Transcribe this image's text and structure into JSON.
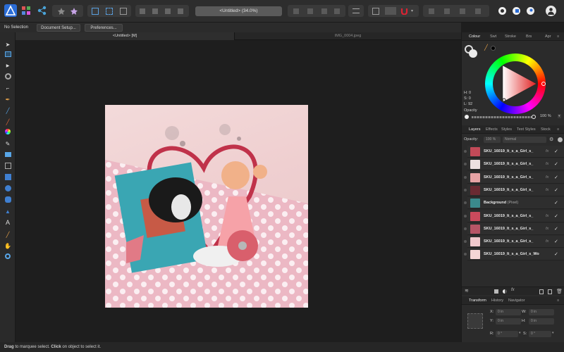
{
  "toolbar": {
    "document_title": "<Untitled> (34.0%)"
  },
  "context": {
    "selection": "No Selection",
    "document_setup": "Document Setup...",
    "preferences": "Preferences..."
  },
  "document_tabs": [
    {
      "label": "<Untitled> [M]",
      "active": true
    },
    {
      "label": "IMG_0004.jpeg",
      "active": false
    }
  ],
  "colour_panel": {
    "tabs": [
      "Colour",
      "Swt",
      "Stroke",
      "Brs",
      "Apr"
    ],
    "hsl": {
      "h": "H: 0",
      "s": "S: 0",
      "l": "L: 92"
    },
    "opacity_label": "Opacity",
    "opacity_value": "100 %"
  },
  "layers_panel": {
    "tabs": [
      "Layers",
      "Effects",
      "Styles",
      "Text Styles",
      "Stock"
    ],
    "opacity_label": "Opacity:",
    "opacity_value": "100 %",
    "blend_mode": "Normal",
    "layers": [
      {
        "name": "SKU_16019_It_s_a_Girl_s_",
        "kind": "",
        "fx": "fx",
        "check": "✓",
        "thumb": "#c24a58"
      },
      {
        "name": "SKU_16019_It_s_a_Girl_s_",
        "kind": "",
        "fx": "fx",
        "check": "✓",
        "thumb": "#ece0e0"
      },
      {
        "name": "SKU_16019_It_s_a_Girl_s_",
        "kind": "",
        "fx": "fx",
        "check": "✓",
        "thumb": "#e6a2a4"
      },
      {
        "name": "SKU_16019_It_s_a_Girl_s_",
        "kind": "",
        "fx": "fx",
        "check": "✓",
        "thumb": "#6a2a32"
      },
      {
        "name": "Background",
        "kind": "(Pixel)",
        "fx": "",
        "check": "✓",
        "thumb": "#3b8a8c"
      },
      {
        "name": "SKU_16019_It_s_a_Girl_s_",
        "kind": "",
        "fx": "fx",
        "check": "✓",
        "thumb": "#c94a5c"
      },
      {
        "name": "SKU_16019_It_s_a_Girl_s_",
        "kind": "",
        "fx": "fx",
        "check": "✓",
        "thumb": "#b65566"
      },
      {
        "name": "SKU_16019_It_s_a_Girl_s_",
        "kind": "",
        "fx": "fx",
        "check": "✓",
        "thumb": "#f0c8cc"
      },
      {
        "name": "SKU_16019_It_s_a_Girl_s_Wo",
        "kind": "",
        "fx": "",
        "check": "✓",
        "thumb": "#f4d6d6"
      }
    ]
  },
  "transform_panel": {
    "tabs": [
      "Transform",
      "History",
      "Navigator"
    ],
    "x_label": "X:",
    "x_value": "0 in",
    "y_label": "Y:",
    "y_value": "0 in",
    "w_label": "W:",
    "w_value": "0 in",
    "h_label": "H:",
    "h_value": "0 in",
    "r_label": "R:",
    "r_value": "0 °",
    "s_label": "S:",
    "s_value": "0 °"
  },
  "status": {
    "drag": "Drag",
    "drag_text": " to marquee select. ",
    "click": "Click",
    "click_text": " on object to select it."
  },
  "colors": {
    "accent": "#2a6cd6",
    "toolbar_bg": "#2d2d2d",
    "canvas_bg": "#1e1e1e",
    "panel_bg": "#2b2b2b"
  }
}
